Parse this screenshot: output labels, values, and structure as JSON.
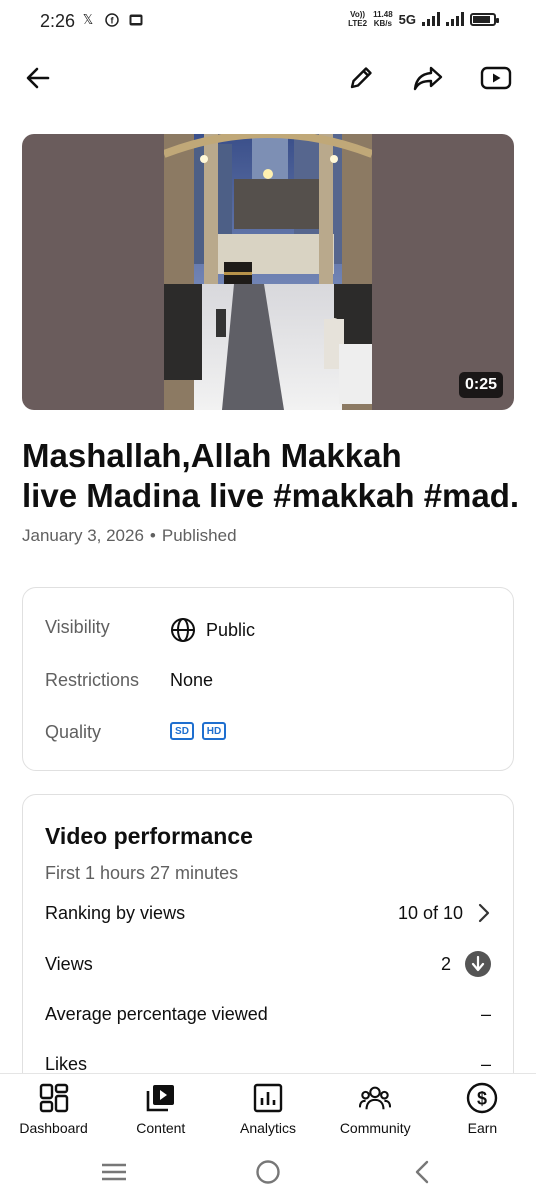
{
  "status_bar": {
    "time": "2:26",
    "notif_icons": [
      "x-icon",
      "facebook-icon",
      "gallery-icon"
    ],
    "network_top": "Vo))",
    "network_bottom": "LTE2",
    "speed_top": "11.48",
    "speed_bottom": "KB/s",
    "network_type": "5G",
    "battery_level": 0.85
  },
  "app_bar": {
    "icons": [
      "back-arrow-icon",
      "edit-pencil-icon",
      "share-icon",
      "youtube-icon"
    ]
  },
  "video": {
    "duration": "0:25",
    "title_line1": "Mashallah,Allah Makkah",
    "title_line2": "live Madina live #makkah #mad..",
    "date": "January 3, 2026",
    "separator": "•",
    "status": "Published"
  },
  "details": {
    "visibility_label": "Visibility",
    "visibility_value": "Public",
    "restrictions_label": "Restrictions",
    "restrictions_value": "None",
    "quality_label": "Quality",
    "quality_badges": [
      "SD",
      "HD"
    ]
  },
  "performance": {
    "title": "Video performance",
    "subtitle": "First 1 hours 27 minutes",
    "rows": [
      {
        "label": "Ranking by views",
        "value": "10 of 10"
      },
      {
        "label": "Views",
        "value": "2"
      },
      {
        "label": "Average percentage viewed",
        "value": "–"
      },
      {
        "label": "Likes",
        "value": "–"
      }
    ]
  },
  "bottom_nav": [
    {
      "label": "Dashboard",
      "icon": "dashboard-icon"
    },
    {
      "label": "Content",
      "icon": "content-icon"
    },
    {
      "label": "Analytics",
      "icon": "analytics-icon"
    },
    {
      "label": "Community",
      "icon": "community-icon"
    },
    {
      "label": "Earn",
      "icon": "earn-dollar-icon"
    }
  ],
  "colors": {
    "accent_blue": "#1f6fcf",
    "text_primary": "#0f0f0f",
    "text_secondary": "#606060"
  }
}
